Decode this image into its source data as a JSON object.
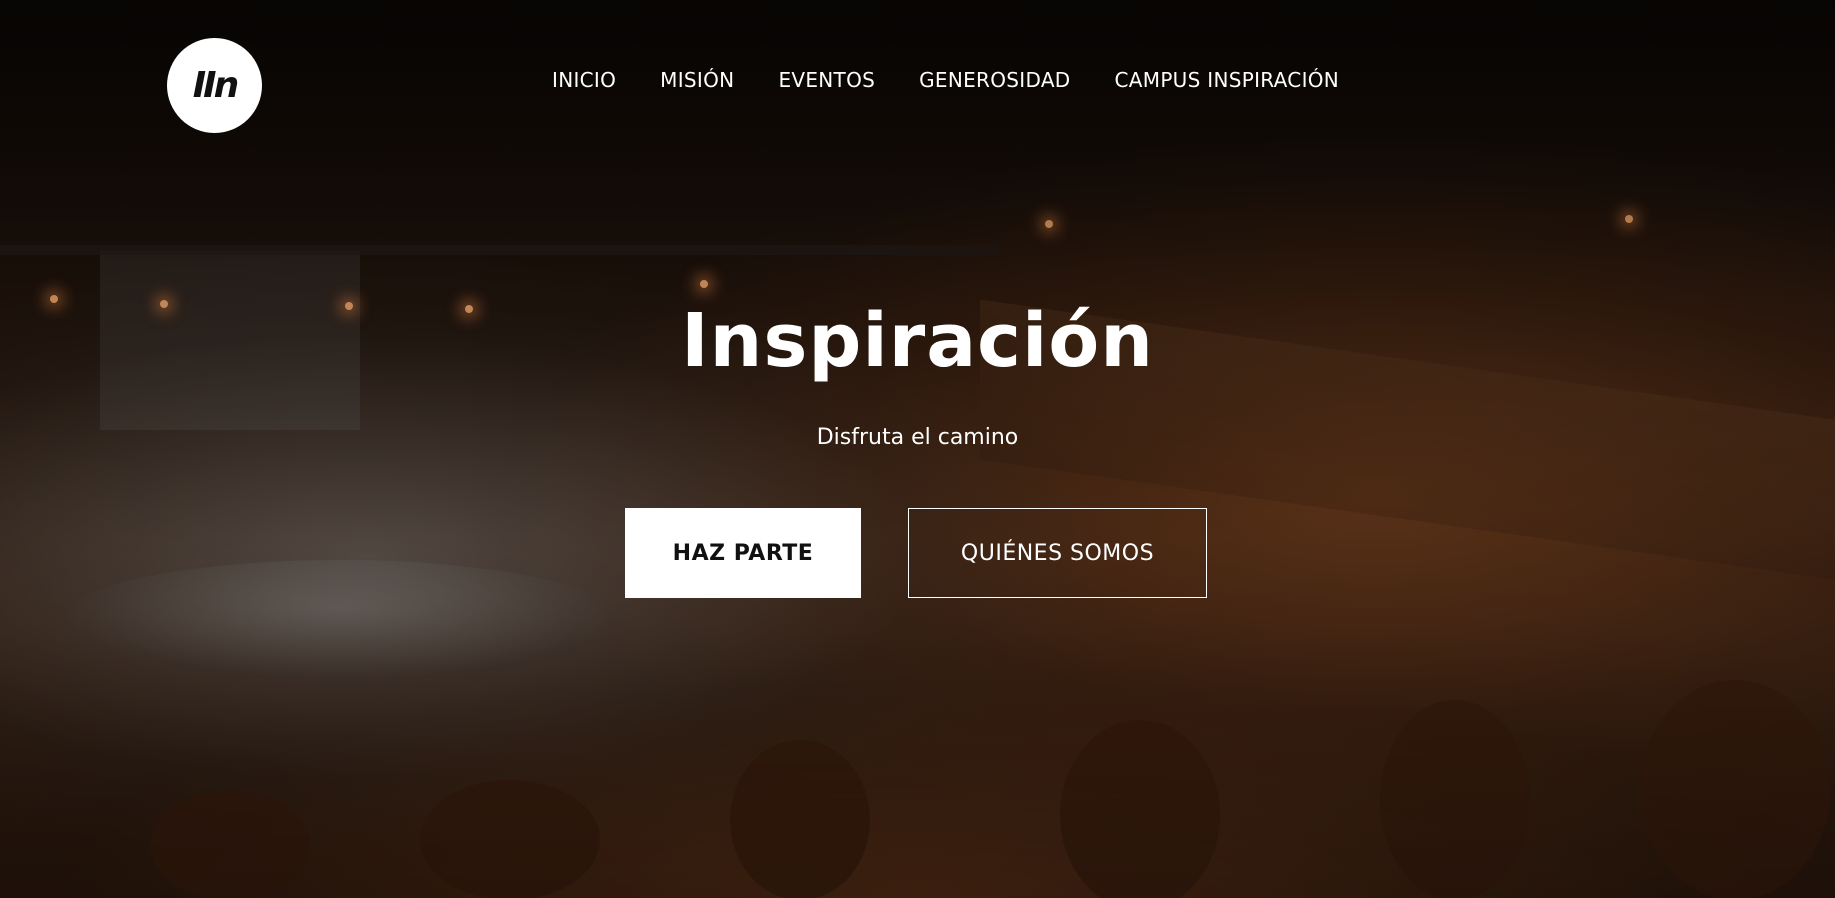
{
  "header": {
    "logo_text": "IIn",
    "nav": [
      {
        "label": "INICIO"
      },
      {
        "label": "MISIÓN"
      },
      {
        "label": "EVENTOS"
      },
      {
        "label": "GENEROSIDAD"
      },
      {
        "label": "CAMPUS INSPIRACIÓN"
      }
    ]
  },
  "hero": {
    "title": "Inspiración",
    "subtitle": "Disfruta el camino",
    "primary_button": "HAZ PARTE",
    "secondary_button": "QUIÉNES SOMOS"
  },
  "colors": {
    "accent_white": "#ffffff",
    "overlay_tone": "#3a2314"
  }
}
